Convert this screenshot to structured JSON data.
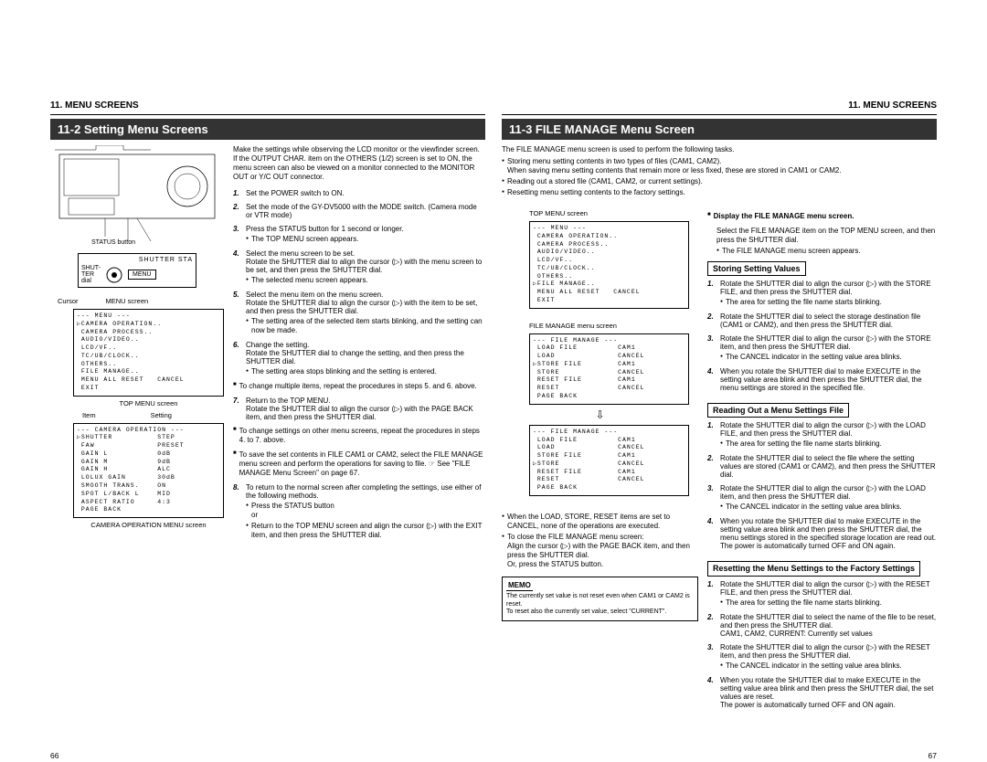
{
  "leftPage": {
    "sectionHeader": "11. MENU SCREENS",
    "title": "11-2  Setting Menu Screens",
    "cameraLabels": {
      "statusBtn": "STATUS button",
      "shutterSta": "SHUTTER  STA",
      "shutTerDial": "SHUT-\nTER\ndial",
      "menu": "MENU",
      "cursor": "Cursor",
      "menuScreen": "MENU screen",
      "item": "Item",
      "setting": "Setting",
      "topMenuScreen": "TOP MENU screen",
      "camOpScreen": "CAMERA OPERATION MENU screen"
    },
    "menuBox1": "--- MENU ---\n▷CAMERA OPERATION..\n CAMERA PROCESS..\n AUDIO/VIDEO..\n LCD/VF..\n TC/UB/CLOCK..\n OTHERS..\n FILE MANAGE..\n MENU ALL RESET   CANCEL\n EXIT",
    "menuBox2": "--- CAMERA OPERATION ---\n▷SHUTTER          STEP\n FAW              PRESET\n GAIN L           0dB\n GAIN M           9dB\n GAIN H           ALC\n LOLUX GAIN       30dB\n SMOOTH TRANS.    ON\n SPOT L/BACK L    MID\n ASPECT RATIO     4:3\n PAGE BACK",
    "intro": "Make the settings while observing the LCD monitor or the viewfinder screen. If the OUTPUT CHAR. item on the OTHERS (1/2) screen is set to ON, the menu screen can also be viewed on a monitor connected to the MONITOR OUT or Y/C OUT connector.",
    "steps": [
      {
        "n": "1.",
        "t": "Set the POWER switch to ON."
      },
      {
        "n": "2.",
        "t": "Set the mode of the GY-DV5000 with the MODE switch. (Camera mode or VTR mode)"
      },
      {
        "n": "3.",
        "t": "Press the STATUS button for 1 second or longer.",
        "bul": [
          "The TOP MENU screen appears."
        ]
      },
      {
        "n": "4.",
        "t": "Select the menu screen to be set.\nRotate the SHUTTER dial to align the cursor (▷) with the menu screen to be set, and then press the SHUTTER dial.",
        "bul": [
          "The selected menu screen appears."
        ]
      },
      {
        "n": "5.",
        "t": "Select the menu item on the menu screen.\nRotate the SHUTTER dial to align the cursor (▷) with the item to be set, and then press the SHUTTER dial.",
        "bul": [
          "The setting area of the selected item starts blinking, and the setting can now be made."
        ]
      },
      {
        "n": "6.",
        "t": "Change the setting.\nRotate the SHUTTER dial to change the setting, and then press the SHUTTER dial.",
        "bul": [
          "The setting area stops blinking and the setting is entered."
        ]
      }
    ],
    "sq1": "To change multiple items, repeat the procedures in steps 5. and 6. above.",
    "step7": {
      "n": "7.",
      "t": "Return to the TOP MENU.\nRotate the SHUTTER dial to align the cursor (▷) with the PAGE BACK item, and then press the SHUTTER dial."
    },
    "sq2": "To change settings on other menu screens, repeat the procedures in steps 4. to 7. above.",
    "sq3": "To save the set contents in FILE CAM1 or CAM2, select the FILE MANAGE menu screen and perform the operations for saving to file. ☞ See \"FILE MANAGE Menu Screen\" on page 67.",
    "step8": {
      "n": "8.",
      "t": "To return to the normal screen after completing the settings, use either of the following methods.",
      "bul": [
        "Press the STATUS button\nor",
        "Return to the TOP MENU screen and align the cursor (▷) with the EXIT item, and then press the SHUTTER dial."
      ]
    },
    "pageNum": "66"
  },
  "rightPage": {
    "sectionHeader": "11. MENU SCREENS",
    "title": "11-3  FILE MANAGE Menu Screen",
    "intro": "The FILE MANAGE menu screen is used to perform the following tasks.",
    "introBullets": [
      "Storing menu setting contents in two types of files (CAM1, CAM2).\nWhen saving menu setting contents that remain more or less fixed, these are stored in CAM1 or CAM2.",
      "Reading out a stored file (CAM1, CAM2, or current settings).",
      "Resetting menu setting contents to the factory settings."
    ],
    "topMenuCaption": "TOP MENU screen",
    "menuBoxTop": "--- MENU ---\n CAMERA OPERATION..\n CAMERA PROCESS..\n AUDIO/VIDEO..\n LCD/VF..\n TC/UB/CLOCK..\n OTHERS..\n▷FILE MANAGE..\n MENU ALL RESET   CANCEL\n EXIT",
    "fileManageCaption": "FILE MANAGE menu screen",
    "menuBoxFM1": "--- FILE MANAGE ---\n LOAD FILE         CAM1\n LOAD              CANCEL\n▷STORE FILE        CAM1\n STORE             CANCEL\n RESET FILE        CAM1\n RESET             CANCEL\n PAGE BACK",
    "menuBoxFM2": "--- FILE MANAGE ---\n LOAD FILE         CAM1\n LOAD              CANCEL\n STORE FILE        CAM1\n▷STORE             CANCEL\n RESET FILE        CAM1\n RESET             CANCEL\n PAGE BACK",
    "extraBullets": [
      "When the LOAD, STORE, RESET items are set to CANCEL, none of the operations are executed.",
      "To close the FILE MANAGE menu screen:\nAlign the cursor (▷) with the PAGE BACK item, and then press the SHUTTER dial.\nOr, press the STATUS button."
    ],
    "memoTitle": "MEMO",
    "memo": "The currently set value is not reset even when CAM1 or CAM2 is reset.\nTo reset also the currently set value, select \"CURRENT\".",
    "display": {
      "head": "Display the FILE MANAGE menu screen.",
      "body": "Select the FILE MANAGE item on the TOP MENU screen, and then press the SHUTTER dial.",
      "bul": "The FILE MANAGE menu screen appears."
    },
    "store": {
      "head": "Storing Setting Values",
      "steps": [
        {
          "n": "1.",
          "t": "Rotate the SHUTTER dial to align the cursor (▷) with the STORE FILE, and then press the SHUTTER dial.",
          "bul": [
            "The area for setting the file name starts blinking."
          ]
        },
        {
          "n": "2.",
          "t": "Rotate the SHUTTER dial to select the storage destination file (CAM1 or CAM2), and then press the SHUTTER dial."
        },
        {
          "n": "3.",
          "t": "Rotate the SHUTTER dial to align the cursor (▷) with the STORE item, and then press the SHUTTER dial.",
          "bul": [
            "The CANCEL indicator in the setting value area blinks."
          ]
        },
        {
          "n": "4.",
          "t": "When you rotate the SHUTTER dial to make EXECUTE in the setting value area blink and then press the SHUTTER dial, the menu settings are stored in the specified file."
        }
      ]
    },
    "read": {
      "head": "Reading Out a Menu Settings File",
      "steps": [
        {
          "n": "1.",
          "t": "Rotate the SHUTTER dial to align the cursor (▷) with the LOAD FILE, and then press the SHUTTER dial.",
          "bul": [
            "The area for setting the file name starts blinking."
          ]
        },
        {
          "n": "2.",
          "t": "Rotate the SHUTTER dial to select the file where the setting values are stored (CAM1 or CAM2), and then press the SHUTTER dial."
        },
        {
          "n": "3.",
          "t": "Rotate the SHUTTER dial to align the cursor (▷) with the LOAD item, and then press the SHUTTER dial.",
          "bul": [
            "The CANCEL indicator in the setting value area blinks."
          ]
        },
        {
          "n": "4.",
          "t": "When you rotate the SHUTTER dial to make EXECUTE in the setting value area blink and then press the SHUTTER dial, the menu settings stored in the specified storage location are read out.\nThe power is automatically turned OFF and ON again."
        }
      ]
    },
    "reset": {
      "head": "Resetting the Menu Settings to the Factory Settings",
      "steps": [
        {
          "n": "1.",
          "t": "Rotate the SHUTTER dial to align the cursor (▷) with the RESET FILE, and then press the SHUTTER dial.",
          "bul": [
            "The area for setting the file name starts blinking."
          ]
        },
        {
          "n": "2.",
          "t": "Rotate the SHUTTER dial to select the name of the file to be reset, and then press the SHUTTER dial.\nCAM1, CAM2, CURRENT: Currently set values"
        },
        {
          "n": "3.",
          "t": "Rotate the SHUTTER dial to align the cursor (▷) with the RESET item, and then press the SHUTTER dial.",
          "bul": [
            "The CANCEL indicator in the setting value area blinks."
          ]
        },
        {
          "n": "4.",
          "t": "When you rotate the SHUTTER dial to make EXECUTE in the setting value area blink and then press the SHUTTER dial, the set values are reset.\nThe power is automatically turned OFF and ON again."
        }
      ]
    },
    "pageNum": "67"
  }
}
